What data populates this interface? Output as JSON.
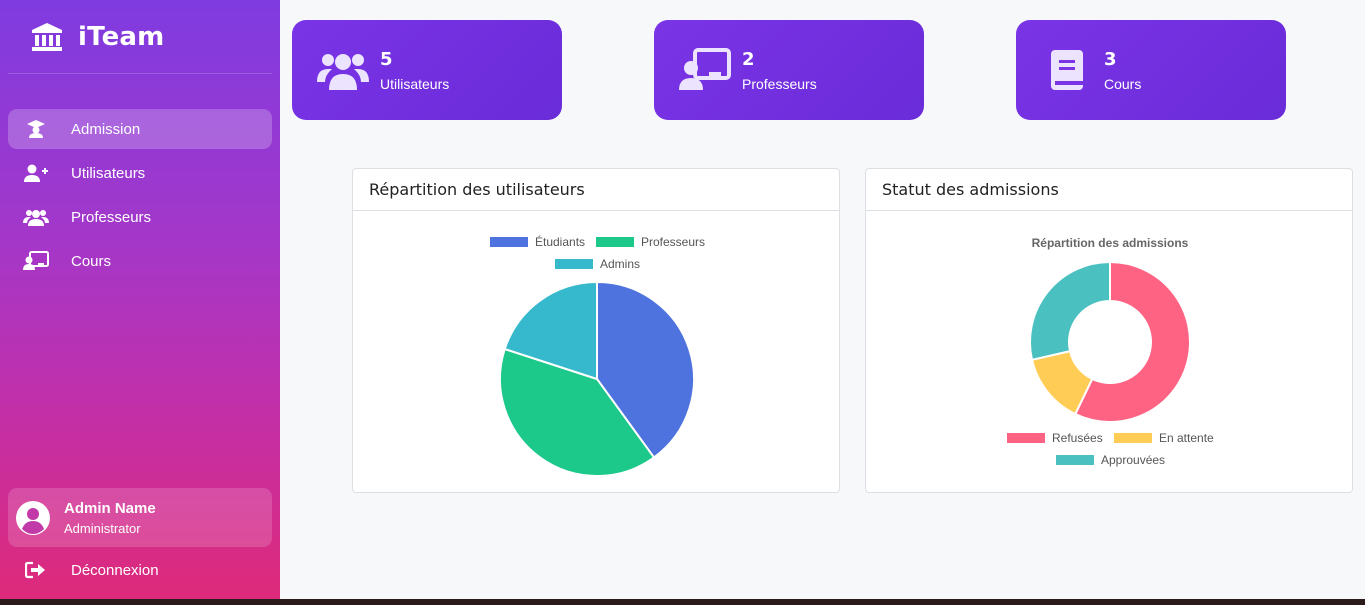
{
  "app": {
    "brand": "iTeam"
  },
  "sidebar": {
    "items": [
      {
        "label": "Admission",
        "icon": "graduate-icon",
        "active": true
      },
      {
        "label": "Utilisateurs",
        "icon": "user-plus-icon",
        "active": false
      },
      {
        "label": "Professeurs",
        "icon": "users-icon",
        "active": false
      },
      {
        "label": "Cours",
        "icon": "chalkboard-icon",
        "active": false
      }
    ],
    "user": {
      "name": "Admin Name",
      "role": "Administrator"
    },
    "logout_label": "Déconnexion"
  },
  "stats": [
    {
      "value": "5",
      "label": "Utilisateurs",
      "icon": "users-icon"
    },
    {
      "value": "2",
      "label": "Professeurs",
      "icon": "chalkboard-teacher-icon"
    },
    {
      "value": "3",
      "label": "Cours",
      "icon": "book-icon"
    }
  ],
  "cards": {
    "users_title": "Répartition des utilisateurs",
    "admissions_title": "Statut des admissions"
  },
  "chart_data": [
    {
      "type": "pie",
      "title": "",
      "categories": [
        "Étudiants",
        "Professeurs",
        "Admins"
      ],
      "values": [
        2,
        2,
        1
      ],
      "colors": [
        "#4e73df",
        "#1cc88a",
        "#36b9cc"
      ],
      "legend": "top"
    },
    {
      "type": "pie",
      "subtype": "doughnut",
      "title": "Répartition des admissions",
      "categories": [
        "Refusées",
        "En attente",
        "Approuvées"
      ],
      "values": [
        4,
        1,
        2
      ],
      "colors": [
        "#ff6384",
        "#ffcd56",
        "#4bc0c0"
      ],
      "legend": "bottom"
    }
  ],
  "colors": {
    "accent": "#6a2bd8",
    "sidebar_top": "#7f3be0",
    "sidebar_bottom": "#de2a7a"
  }
}
